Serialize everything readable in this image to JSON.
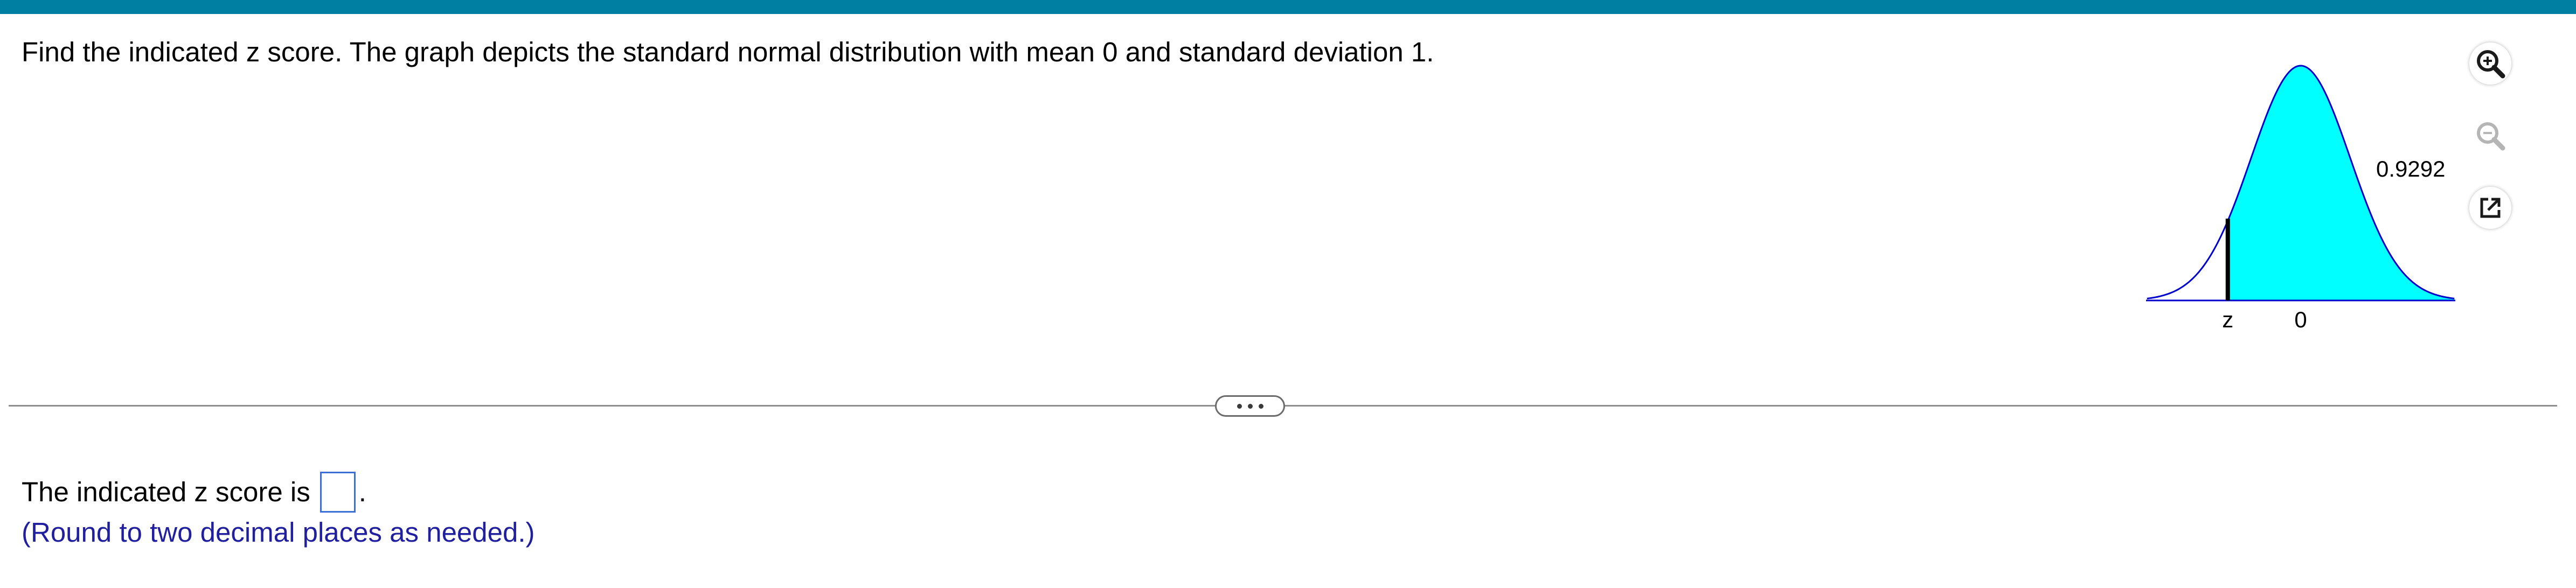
{
  "header": {
    "accent_color": "#007fa3"
  },
  "question": {
    "text": "Find the indicated z score. The graph depicts the standard normal distribution with mean 0 and standard deviation 1."
  },
  "graph": {
    "area_label": "0.9292",
    "z_label": "z",
    "mean_label": "0",
    "shaded_area": 0.9292,
    "shaded_side": "right of z",
    "fill_color": "#00ffff",
    "curve_color": "#0000cc"
  },
  "tools": {
    "zoom_in": "zoom-in-icon",
    "zoom_out": "zoom-out-icon",
    "popout": "popout-icon"
  },
  "answer": {
    "prefix": "The indicated z score is",
    "suffix": ".",
    "value": "",
    "hint": "(Round to two decimal places as needed.)",
    "box_color": "#3b6fd6",
    "hint_color": "#1f1fa0"
  }
}
